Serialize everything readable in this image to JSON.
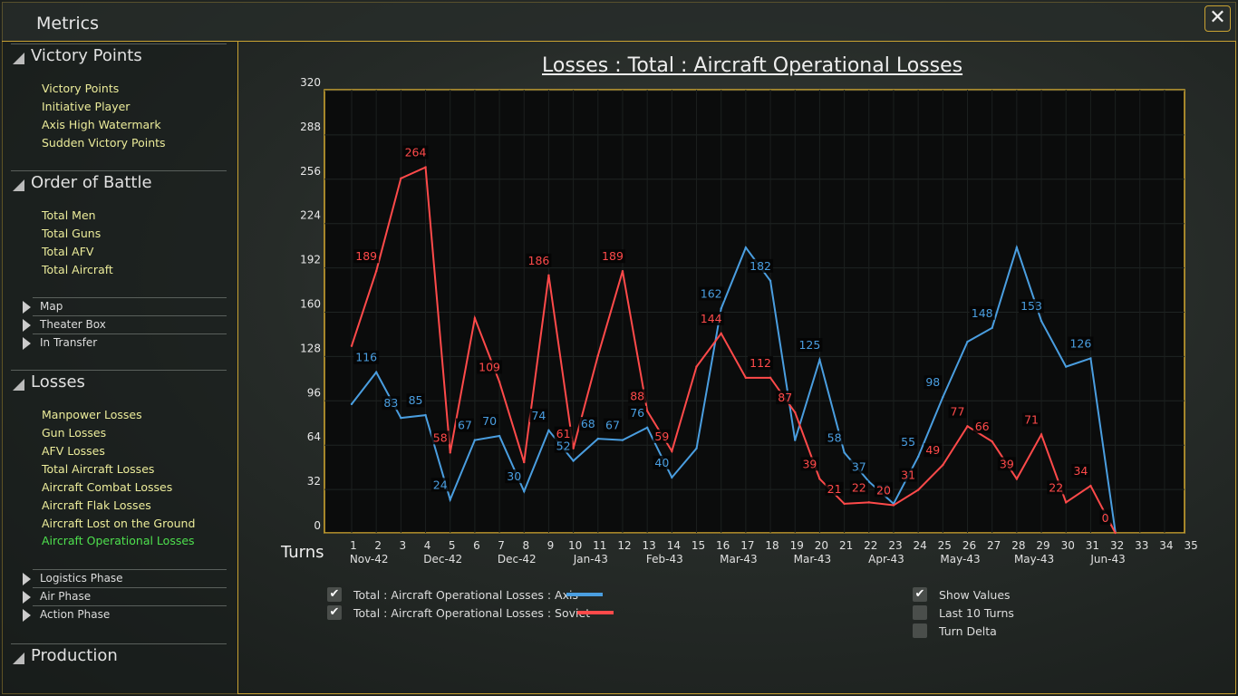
{
  "window": {
    "title": "Metrics",
    "close_icon": "close-x-icon"
  },
  "sidebar": {
    "sections": [
      {
        "label": "Victory Points",
        "items": [
          "Victory Points",
          "Initiative Player",
          "Axis High Watermark",
          "Sudden Victory Points"
        ]
      },
      {
        "label": "Order of Battle",
        "items": [
          "Total Men",
          "Total Guns",
          "Total AFV",
          "Total Aircraft"
        ],
        "subs": [
          "Map",
          "Theater Box",
          "In Transfer"
        ]
      },
      {
        "label": "Losses",
        "items": [
          "Manpower Losses",
          "Gun Losses",
          "AFV Losses",
          "Total Aircraft Losses",
          "Aircraft Combat Losses",
          "Aircraft Flak Losses",
          "Aircraft Lost on the Ground",
          "Aircraft Operational Losses"
        ],
        "active": "Aircraft Operational Losses",
        "subs": [
          "Logistics Phase",
          "Air Phase",
          "Action Phase"
        ]
      },
      {
        "label": "Production"
      }
    ]
  },
  "chart_data": {
    "type": "line",
    "title": "Losses : Total : Aircraft Operational Losses",
    "xlabel": "Turns",
    "x": [
      1,
      2,
      3,
      4,
      5,
      6,
      7,
      8,
      9,
      10,
      11,
      12,
      13,
      14,
      15,
      16,
      17,
      18,
      19,
      20,
      21,
      22,
      23,
      24,
      25,
      26,
      27,
      28,
      29,
      30,
      31,
      32
    ],
    "xticks": [
      1,
      2,
      3,
      4,
      5,
      6,
      7,
      8,
      9,
      10,
      11,
      12,
      13,
      14,
      15,
      16,
      17,
      18,
      19,
      20,
      21,
      22,
      23,
      24,
      25,
      26,
      27,
      28,
      29,
      30,
      31,
      32,
      33,
      34,
      35
    ],
    "date_labels": [
      {
        "turn": 2,
        "label": "Nov-42"
      },
      {
        "turn": 5,
        "label": "Dec-42"
      },
      {
        "turn": 8,
        "label": "Dec-42"
      },
      {
        "turn": 11,
        "label": "Jan-43"
      },
      {
        "turn": 14,
        "label": "Feb-43"
      },
      {
        "turn": 17,
        "label": "Mar-43"
      },
      {
        "turn": 20,
        "label": "Mar-43"
      },
      {
        "turn": 23,
        "label": "Apr-43"
      },
      {
        "turn": 26,
        "label": "May-43"
      },
      {
        "turn": 29,
        "label": "May-43"
      },
      {
        "turn": 32,
        "label": "Jun-43"
      }
    ],
    "ylim": [
      0,
      320
    ],
    "yticks": [
      0,
      32,
      64,
      96,
      128,
      160,
      192,
      224,
      256,
      288,
      320
    ],
    "grid": true,
    "series": [
      {
        "name": "Total : Aircraft Operational Losses : Axis",
        "color": "#4a9ee0",
        "values": [
          93,
          116,
          83,
          85,
          24,
          67,
          70,
          30,
          74,
          52,
          68,
          67,
          76,
          40,
          61,
          162,
          206,
          182,
          67,
          125,
          58,
          37,
          21,
          55,
          98,
          138,
          148,
          206,
          153,
          120,
          126,
          1
        ],
        "value_labels": [
          null,
          116,
          83,
          85,
          24,
          67,
          70,
          30,
          74,
          52,
          68,
          67,
          76,
          40,
          null,
          162,
          null,
          182,
          null,
          125,
          58,
          37,
          21,
          55,
          98,
          null,
          148,
          null,
          153,
          null,
          126,
          1
        ]
      },
      {
        "name": "Total : Aircraft Operational Losses : Soviet",
        "color": "#ff4a4a",
        "values": [
          135,
          189,
          256,
          264,
          58,
          155,
          109,
          51,
          186,
          61,
          128,
          189,
          88,
          59,
          120,
          144,
          112,
          112,
          87,
          39,
          21,
          22,
          20,
          31,
          49,
          77,
          66,
          39,
          71,
          22,
          34,
          0
        ],
        "value_labels": [
          null,
          189,
          null,
          264,
          58,
          null,
          109,
          null,
          186,
          61,
          null,
          189,
          88,
          59,
          null,
          144,
          null,
          112,
          87,
          39,
          21,
          22,
          20,
          31,
          49,
          77,
          66,
          39,
          71,
          22,
          34,
          0
        ]
      }
    ]
  },
  "options": [
    {
      "label": "Show Values",
      "checked": true
    },
    {
      "label": "Last 10 Turns",
      "checked": false
    },
    {
      "label": "Turn Delta",
      "checked": false
    }
  ],
  "legend_checks": [
    true,
    true
  ]
}
